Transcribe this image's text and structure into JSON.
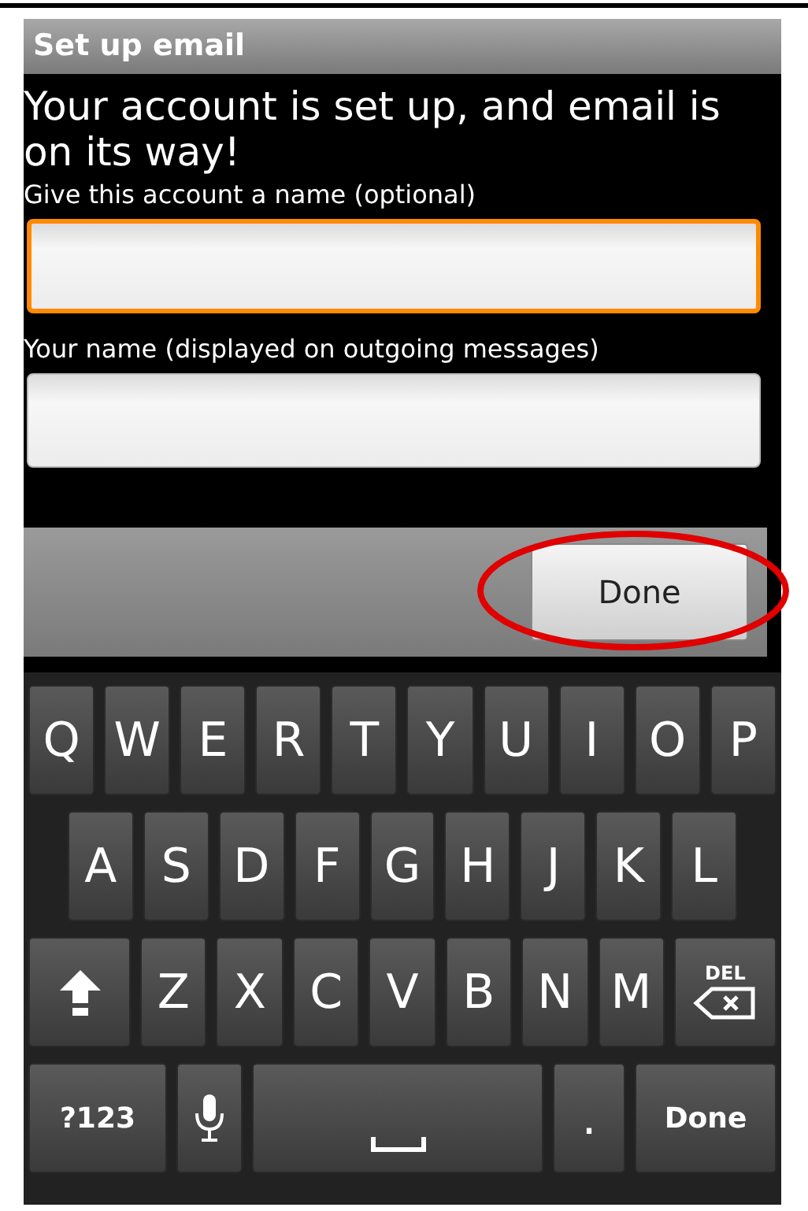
{
  "title_bar": {
    "title": "Set up email"
  },
  "heading": "Your account is set up, and email is on its way!",
  "fields": [
    {
      "label": "Give this account a name (optional)",
      "focused": true
    },
    {
      "label": "Your name (displayed on outgoing messages)",
      "focused": false
    }
  ],
  "action_bar": {
    "button": "Done",
    "highlighted": true
  },
  "keyboard": {
    "rows": [
      {
        "keys": [
          {
            "kind": "letter",
            "label": "Q"
          },
          {
            "kind": "letter",
            "label": "W"
          },
          {
            "kind": "letter",
            "label": "E"
          },
          {
            "kind": "letter",
            "label": "R"
          },
          {
            "kind": "letter",
            "label": "T"
          },
          {
            "kind": "letter",
            "label": "Y"
          },
          {
            "kind": "letter",
            "label": "U"
          },
          {
            "kind": "letter",
            "label": "I"
          },
          {
            "kind": "letter",
            "label": "O"
          },
          {
            "kind": "letter",
            "label": "P"
          }
        ]
      },
      {
        "keys": [
          {
            "kind": "letter",
            "label": "A"
          },
          {
            "kind": "letter",
            "label": "S"
          },
          {
            "kind": "letter",
            "label": "D"
          },
          {
            "kind": "letter",
            "label": "F"
          },
          {
            "kind": "letter",
            "label": "G"
          },
          {
            "kind": "letter",
            "label": "H"
          },
          {
            "kind": "letter",
            "label": "J"
          },
          {
            "kind": "letter",
            "label": "K"
          },
          {
            "kind": "letter",
            "label": "L"
          }
        ]
      },
      {
        "keys": [
          {
            "kind": "shift"
          },
          {
            "kind": "letter",
            "label": "Z"
          },
          {
            "kind": "letter",
            "label": "X"
          },
          {
            "kind": "letter",
            "label": "C"
          },
          {
            "kind": "letter",
            "label": "V"
          },
          {
            "kind": "letter",
            "label": "B"
          },
          {
            "kind": "letter",
            "label": "N"
          },
          {
            "kind": "letter",
            "label": "M"
          },
          {
            "kind": "delete",
            "label": "DEL"
          }
        ]
      },
      {
        "keys": [
          {
            "kind": "symbols",
            "label": "?123"
          },
          {
            "kind": "mic"
          },
          {
            "kind": "space"
          },
          {
            "kind": "letter",
            "label": "."
          },
          {
            "kind": "action",
            "label": "Done"
          }
        ]
      }
    ]
  }
}
